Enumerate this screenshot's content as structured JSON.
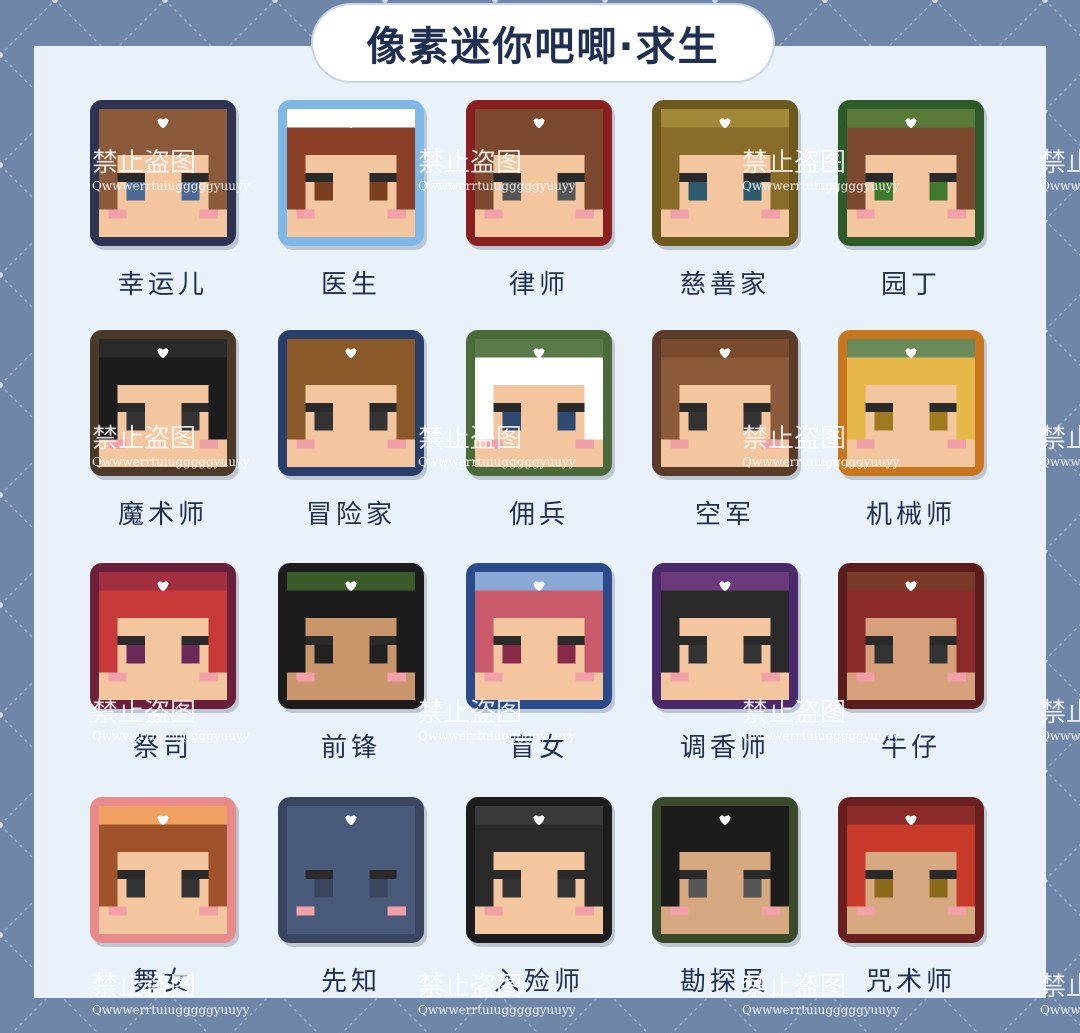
{
  "title": "像素迷你吧唧·求生",
  "watermark": {
    "text": "禁止盗图",
    "handle": "Qwwwerrtuiugggggyuuyy"
  },
  "characters": [
    {
      "label": "幸运儿",
      "frame": "#2d3350",
      "hair": "#8a5a3a",
      "skin": "#f3c6a0",
      "eye": "#4d6a96",
      "top": "#8a5a3a"
    },
    {
      "label": "医生",
      "frame": "#7fb8e6",
      "hair": "#8a3f26",
      "skin": "#f3c6a0",
      "eye": "#7a3f1e",
      "top": "#ffffff"
    },
    {
      "label": "律师",
      "frame": "#8a1f1f",
      "hair": "#7b4a2e",
      "skin": "#f3c6a0",
      "eye": "#555555",
      "top": "#7b4a2e"
    },
    {
      "label": "慈善家",
      "frame": "#6b5a1c",
      "hair": "#8a6c2a",
      "skin": "#f3c6a0",
      "eye": "#2e5a6e",
      "top": "#a08a3a"
    },
    {
      "label": "园丁",
      "frame": "#2e5a2a",
      "hair": "#7b4a2e",
      "skin": "#f3c6a0",
      "eye": "#3f7a2e",
      "top": "#5a7a3a"
    },
    {
      "label": "魔术师",
      "frame": "#4a3828",
      "hair": "#1c1c1c",
      "skin": "#f3c6a0",
      "eye": "#333333",
      "top": "#2a2a2a"
    },
    {
      "label": "冒险家",
      "frame": "#2a3e6a",
      "hair": "#8a5a2a",
      "skin": "#f3c6a0",
      "eye": "#333333",
      "top": "#8a5a2a"
    },
    {
      "label": "佣兵",
      "frame": "#4a6a3a",
      "hair": "#ffffff",
      "skin": "#f3c6a0",
      "eye": "#2e4a6e",
      "top": "#5a7a4a"
    },
    {
      "label": "空军",
      "frame": "#5a3a28",
      "hair": "#8a5a3a",
      "skin": "#f3c6a0",
      "eye": "#333333",
      "top": "#7a4a2e"
    },
    {
      "label": "机械师",
      "frame": "#c8761e",
      "hair": "#e6b84a",
      "skin": "#f3c6a0",
      "eye": "#a07a1e",
      "top": "#6a8a5a"
    },
    {
      "label": "祭司",
      "frame": "#6a1f3a",
      "hair": "#c83a3a",
      "skin": "#f3c6a0",
      "eye": "#6a2a5a",
      "top": "#a03040"
    },
    {
      "label": "前锋",
      "frame": "#1c1c1c",
      "hair": "#1c1c1c",
      "skin": "#c8966a",
      "eye": "#222222",
      "top": "#3a5a2a"
    },
    {
      "label": "盲女",
      "frame": "#2a4a8a",
      "hair": "#c85a6a",
      "skin": "#f3c6a0",
      "eye": "#8a2a4a",
      "top": "#8aa8d6"
    },
    {
      "label": "调香师",
      "frame": "#4a2a6a",
      "hair": "#2a2a2a",
      "skin": "#f3c6a0",
      "eye": "#333333",
      "top": "#6a3a7a"
    },
    {
      "label": "牛仔",
      "frame": "#5a1c1c",
      "hair": "#8a2a2a",
      "skin": "#d6a07a",
      "eye": "#333333",
      "top": "#7a3a2a"
    },
    {
      "label": "舞女",
      "frame": "#e88a8a",
      "hair": "#a0522a",
      "skin": "#f3c6a0",
      "eye": "#333333",
      "top": "#f0a060"
    },
    {
      "label": "先知",
      "frame": "#3a4660",
      "hair": "#4a5a7a",
      "skin": "#4a5a7a",
      "eye": "#3a4660",
      "top": "#4a5a7a"
    },
    {
      "label": "入殓师",
      "frame": "#1c1c1c",
      "hair": "#2a2a2a",
      "skin": "#f3c6a0",
      "eye": "#333333",
      "top": "#3a3a3a"
    },
    {
      "label": "勘探员",
      "frame": "#3a4a2a",
      "hair": "#1c1c1c",
      "skin": "#d6a880",
      "eye": "#555555",
      "top": "#1c1c1c"
    },
    {
      "label": "咒术师",
      "frame": "#6a1f1f",
      "hair": "#c83a2a",
      "skin": "#d6a880",
      "eye": "#8a6a1a",
      "top": "#8a2a2a"
    }
  ]
}
